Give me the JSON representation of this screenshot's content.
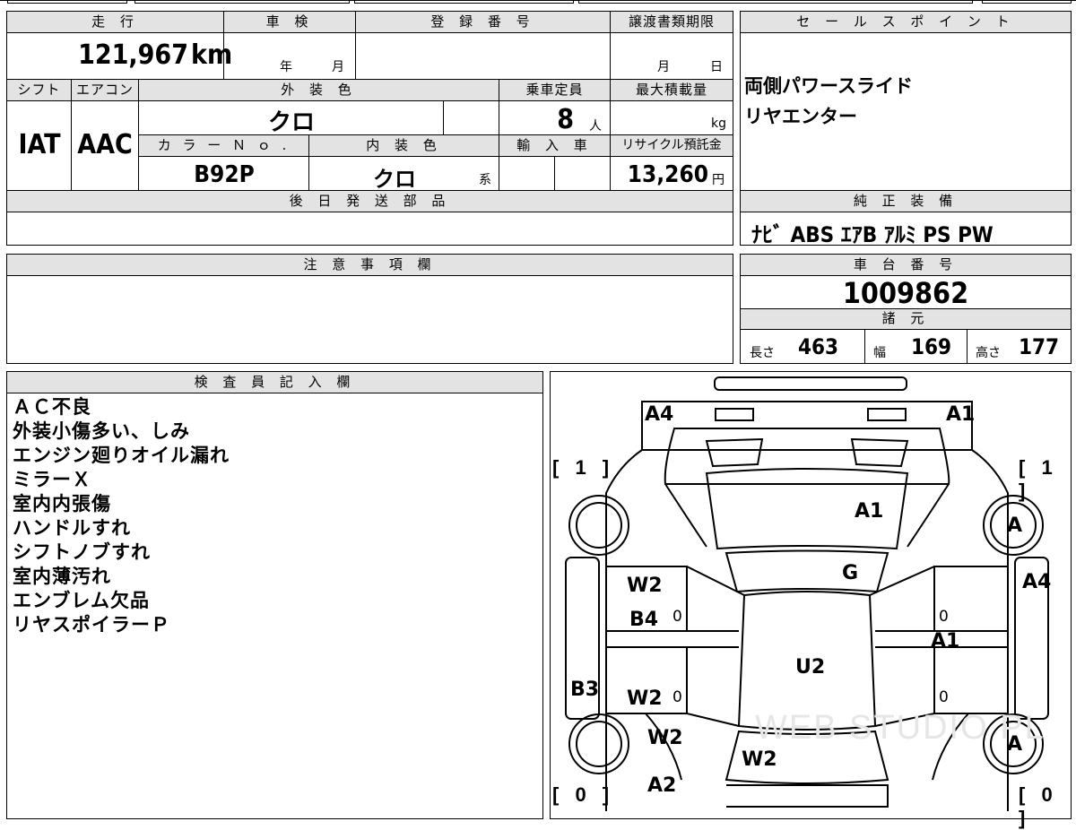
{
  "sheet": {
    "mileage": {
      "header": "走 行",
      "value": "121,967",
      "unit": "km"
    },
    "inspection": {
      "header": "車 検",
      "year_label": "年",
      "month_label": "月"
    },
    "registration": {
      "header": "登 録 番 号",
      "value": ""
    },
    "transfer_deadline": {
      "header": "譲渡書類期限",
      "month_label": "月",
      "day_label": "日"
    },
    "shift": {
      "header": "シフト",
      "value": "IAT"
    },
    "aircon": {
      "header": "エアコン",
      "value": "AAC"
    },
    "exterior_color": {
      "header": "外 装 色",
      "value": "クロ"
    },
    "capacity": {
      "header": "乗車定員",
      "value": "8",
      "unit": "人"
    },
    "max_load": {
      "header": "最大積載量",
      "value": "",
      "unit": "kg"
    },
    "color_no": {
      "header": "カ ラ ー Ｎ ｏ .",
      "value": "B92P"
    },
    "interior_color": {
      "header": "内 装 色",
      "value": "クロ",
      "suffix": "系"
    },
    "import": {
      "header": "輸 入 車"
    },
    "recycle_fee": {
      "header": "リサイクル預託金",
      "value": "13,260",
      "unit": "円"
    },
    "later_parts": {
      "header": "後 日 発 送 部 品",
      "value": ""
    },
    "sales_points": {
      "header": "セ ー ル ス ポ イ ン ト",
      "lines": [
        "両側パワースライド",
        "リヤエンター"
      ]
    },
    "genuine_equipment": {
      "header": "純 正 装 備",
      "value": "ﾅﾋﾞ ABS ｴｱB ｱﾙﾐ PS PW"
    },
    "caution": {
      "header": "注 意 事 項 欄",
      "value": ""
    },
    "chassis_no": {
      "header": "車 台 番 号",
      "value": "1009862"
    },
    "specs": {
      "header": "諸 元",
      "length_label": "長さ",
      "length": "463",
      "width_label": "幅",
      "width": "169",
      "height_label": "高さ",
      "height": "177"
    },
    "inspector_notes": {
      "header": "検 査 員 記 入 欄",
      "lines": [
        "ＡＣ不良",
        "外装小傷多い、しみ",
        "エンジン廻りオイル漏れ",
        "ミラーＸ",
        "室内内張傷",
        "ハンドルすれ",
        "シフトノブすれ",
        "室内薄汚れ",
        "エンブレム欠品",
        "リヤスポイラーＰ"
      ]
    }
  },
  "diagram": {
    "marks": {
      "front_left_corner": "A4",
      "front_right_corner": "A1",
      "hood": "A1",
      "windshield": "G",
      "roof": "U2",
      "right_front_wheel": "A",
      "right_rear_wheel": "A",
      "right_side_front": "A4",
      "right_side_mid": "A1",
      "left_front_door": "W2",
      "left_front_door_2": "B4",
      "left_rear_door": "W2",
      "left_rocker": "B3",
      "left_rear_quarter": "W2",
      "rear_gate": "W2",
      "rear_bumper": "A2"
    },
    "tires": {
      "front_left": "[ 1 ]",
      "front_right": "[ 1 ]",
      "rear_left": "[ 0 ]",
      "rear_right": "[ 0 ]"
    },
    "small_zeros": [
      "0",
      "0",
      "0",
      "0"
    ],
    "watermark": "WEB STUDIO PL"
  }
}
